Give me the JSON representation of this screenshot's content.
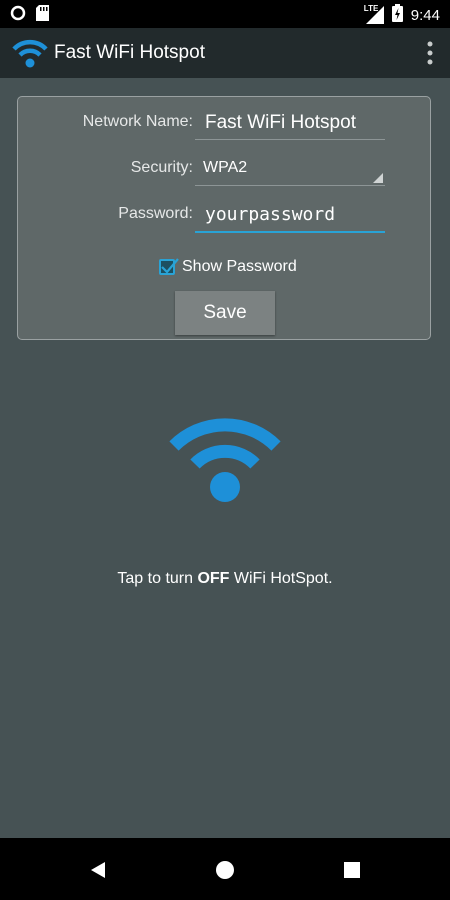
{
  "status_bar": {
    "time": "9:44",
    "network_type": "LTE",
    "icons": [
      "notification-circle-icon",
      "sd-card-icon",
      "signal-icon",
      "battery-charging-icon"
    ]
  },
  "app_bar": {
    "title": "Fast WiFi Hotspot",
    "logo_icon": "wifi-icon",
    "menu_icon": "overflow-menu-icon"
  },
  "settings": {
    "network_name_label": "Network Name:",
    "network_name_value": "Fast WiFi Hotspot",
    "security_label": "Security:",
    "security_value": "WPA2",
    "password_label": "Password:",
    "password_value": "yourpassword",
    "show_password_label": "Show Password",
    "show_password_checked": true,
    "save_label": "Save"
  },
  "hotspot": {
    "icon": "wifi-icon",
    "hint_prefix": "Tap to turn ",
    "hint_emphasis": "OFF",
    "hint_suffix": " WiFi HotSpot."
  },
  "nav_bar": {
    "buttons": [
      "back-icon",
      "home-icon",
      "recents-icon"
    ]
  },
  "colors": {
    "background": "#465254",
    "app_bar": "#222a2c",
    "accent": "#29a3d6",
    "wifi_blue": "#1e90d8"
  }
}
